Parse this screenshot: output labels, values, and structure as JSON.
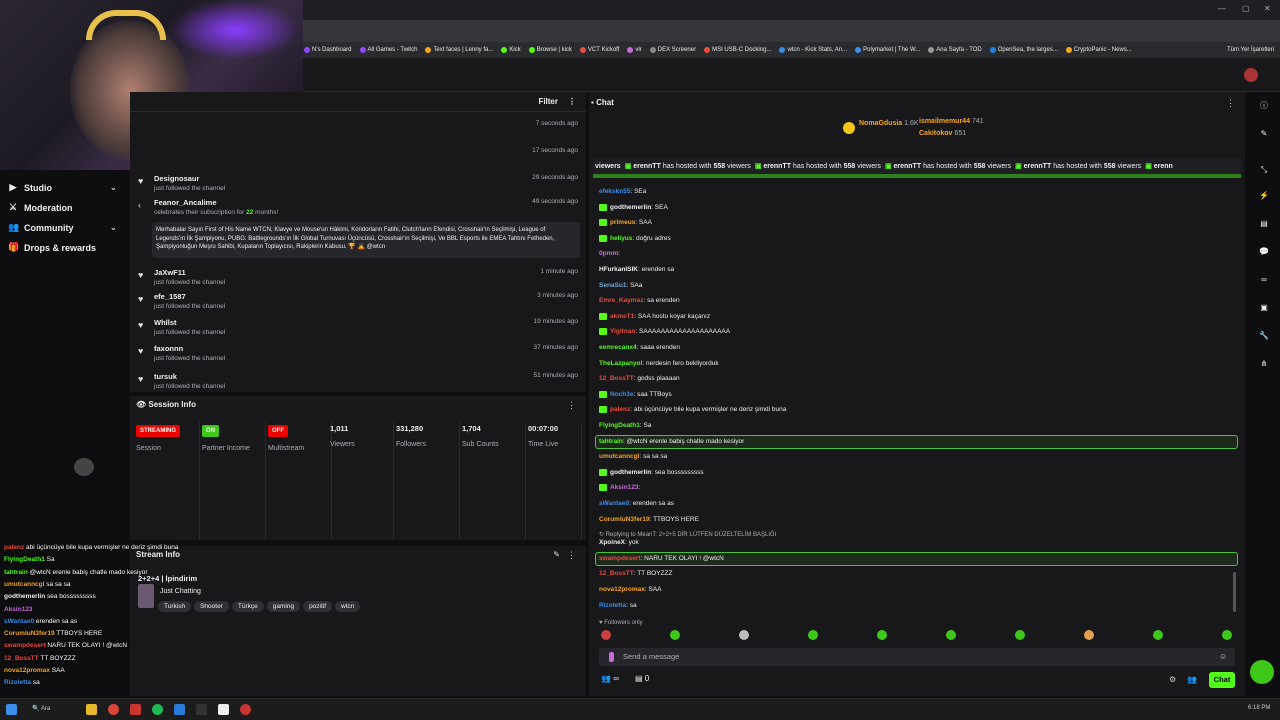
{
  "bookmarks": [
    "N's Dashboard",
    "All Games - Twitch",
    "Text faces | Lenny fa...",
    "Kick",
    "Browse | kick",
    "VCT Kickoff",
    "vlr",
    "DEX Screener",
    "MSI USB-C Docking...",
    "wtcn - Kick Stats, An...",
    "Polymarket | The W...",
    "Ana Sayfa - TOD",
    "OpenSea, the larges...",
    "CryptoPanic - News..."
  ],
  "bookmarks_more": "Tüm Yer İşaretleri",
  "nav": {
    "items": [
      {
        "label": "Studio",
        "icon": "video-icon",
        "chevron": true
      },
      {
        "label": "Moderation",
        "icon": "sword-icon",
        "chevron": false
      },
      {
        "label": "Community",
        "icon": "people-icon",
        "chevron": true
      },
      {
        "label": "Drops & rewards",
        "icon": "gift-icon",
        "chevron": false
      }
    ]
  },
  "activity": {
    "filter_label": "Filter",
    "rows": [
      {
        "name": "",
        "sub": "",
        "time": "7 seconds ago"
      },
      {
        "name": "",
        "sub": "",
        "time": "17 seconds ago"
      },
      {
        "name": "Designosaur",
        "sub": "just followed the channel",
        "time": "29 seconds ago"
      },
      {
        "name": "Feanor_Ancalime",
        "sub": "celebrates their subscription for",
        "months": "22",
        "months_suffix": " months!",
        "time": "49 seconds ago",
        "message": "Merhabalar Sayın First of His Name WTCN, Klavye ve Mouse'un Hâkimi, Koridorların Fatihi, Clutch'ların Efendisi, Crosshair'ın Seçilmişi, League of Legends'ın İlk Şampiyonu, PUBG: Battlegrounds'ın İlk Global Turnuvası Üçüncüsü, Crosshair'ın Seçilmişi, Ve BBL Esports ile EMEA Tahtını Fetheden, Şampiyonluğun Meşru Sahibi, Kupaların Toplayıcısı, Rakiplerin Kabusu. 🏆 🙇 @wtcn"
      },
      {
        "name": "JaXwF11",
        "sub": "just followed the channel",
        "time": "1 minute ago"
      },
      {
        "name": "efe_1587",
        "sub": "just followed the channel",
        "time": "3 minutes ago"
      },
      {
        "name": "Whllst",
        "sub": "just followed the channel",
        "time": "19 minutes ago"
      },
      {
        "name": "faxonnn",
        "sub": "just followed the channel",
        "time": "37 minutes ago"
      },
      {
        "name": "tursuk",
        "sub": "just followed the channel",
        "time": "51 minutes ago"
      }
    ]
  },
  "session": {
    "title": "Session Info",
    "cols": [
      {
        "pill": "STREAMING",
        "pill_color": "#eb0400",
        "label": "Session"
      },
      {
        "pill": "ON",
        "pill_color": "#3ec91a",
        "label": "Partner Income"
      },
      {
        "pill": "OFF",
        "pill_color": "#eb0400",
        "label": "Multistream"
      },
      {
        "value": "1,011",
        "label": "Viewers"
      },
      {
        "value": "331,280",
        "label": "Followers"
      },
      {
        "value": "1,704",
        "label": "Sub Counts"
      },
      {
        "value": "00:07:00",
        "label": "Time Live"
      }
    ]
  },
  "stream_info": {
    "title": "Stream Info",
    "stream_title": "2+2+4 | İpindirim",
    "category": "Just Chatting",
    "tags": [
      "Turkish",
      "Shooter",
      "Türkçe",
      "gaming",
      "pozitif",
      "wtcn"
    ]
  },
  "chat": {
    "title": "Chat",
    "top_gifters": [
      {
        "name": "NomaGdusia",
        "count": "1.6K"
      },
      {
        "name": "ismailmemur44",
        "count": "741"
      },
      {
        "name": "Cakitokov",
        "count": "651"
      }
    ],
    "hosted_segments": [
      {
        "user": "viewers",
        "text": ""
      },
      {
        "user": "erennTT",
        "text": "has hosted with",
        "num": "558",
        "tail": "viewers"
      },
      {
        "user": "erennTT",
        "text": "has hosted with",
        "num": "558",
        "tail": "viewers"
      },
      {
        "user": "erennTT",
        "text": "has hosted with",
        "num": "558",
        "tail": "viewers"
      },
      {
        "user": "erennTT",
        "text": "has hosted with",
        "num": "558",
        "tail": "viewers"
      },
      {
        "user": "erenn",
        "text": "",
        "num": "",
        "tail": ""
      }
    ],
    "messages": [
      {
        "user": "efekskn55",
        "color": "#3b8eea",
        "text": "SEa",
        "badge": false,
        "highlight": false
      },
      {
        "user": "godthemerlin",
        "color": "#efeff1",
        "text": "SEA",
        "badge": true,
        "highlight": false
      },
      {
        "user": "primeus",
        "color": "#f5a623",
        "text": "SAA",
        "badge": true,
        "highlight": false
      },
      {
        "user": "heliyus",
        "color": "#53fc18",
        "text": "doğru adres",
        "badge": true,
        "highlight": false
      },
      {
        "user": "0pmm",
        "color": "#c86dd7",
        "text": "",
        "badge": false,
        "highlight": false
      },
      {
        "user": "HFurkanISIK",
        "color": "#efeff1",
        "text": "erenden sa",
        "badge": false,
        "highlight": false
      },
      {
        "user": "SenaSu1",
        "color": "#6fa8dc",
        "text": "SAa",
        "badge": false,
        "highlight": false
      },
      {
        "user": "Emre_Kaymaz",
        "color": "#e74c3c",
        "text": "sa erenden",
        "badge": false,
        "highlight": false
      },
      {
        "user": "akmeT1",
        "color": "#e74c3c",
        "text": "SAA hostu koyar kaçanız",
        "badge": true,
        "highlight": false
      },
      {
        "user": "Yigitnan",
        "color": "#e74c3c",
        "text": "SAAAAAAAAAAAAAAAAAAAA",
        "badge": true,
        "highlight": false
      },
      {
        "user": "eemrecanx4",
        "color": "#53fc18",
        "text": "saaa erenden",
        "badge": false,
        "highlight": false
      },
      {
        "user": "TheLazpanyol",
        "color": "#53fc18",
        "text": "nerdesin fero bekliyorduk",
        "badge": false,
        "highlight": false
      },
      {
        "user": "12_BossTT",
        "color": "#e74c3c",
        "text": "godss plaaaan",
        "badge": false,
        "highlight": false
      },
      {
        "user": "Noch3e",
        "color": "#3b8eea",
        "text": "saa TTBoys",
        "badge": true,
        "highlight": false
      },
      {
        "user": "palenz",
        "color": "#e74c3c",
        "text": "abi üçüncüye bile kupa vermişler ne deriz şimdi buna",
        "badge": true,
        "highlight": false
      },
      {
        "user": "FlyingDeath1",
        "color": "#53fc18",
        "text": "Sa",
        "badge": false,
        "highlight": false
      },
      {
        "user": "tahtrain",
        "color": "#53fc18",
        "text": "@wtcN erenle babiş chatle mado kesiyor",
        "badge": false,
        "highlight": true
      },
      {
        "user": "umutcanncgl",
        "color": "#f5a623",
        "text": "sa sa sa",
        "badge": false,
        "highlight": false
      },
      {
        "user": "godthemerlin",
        "color": "#efeff1",
        "text": "sea bosssssssss",
        "badge": true,
        "highlight": false
      },
      {
        "user": "Aksin123",
        "color": "#c86dd7",
        "text": "",
        "badge": true,
        "highlight": false
      },
      {
        "user": "sWantae0",
        "color": "#3b8eea",
        "text": "erenden sa as",
        "badge": false,
        "highlight": false
      },
      {
        "user": "CorumluN3fer19",
        "color": "#f5a623",
        "text": "TTBOYS HERE",
        "badge": false,
        "highlight": false
      },
      {
        "user": "XpoineX",
        "color": "#efeff1",
        "text": "yok",
        "badge": false,
        "highlight": false,
        "reply": "Replying to MeanT: 2+2+5 DİR LÜTFEN DÜZELTELİM BAŞLIĞI"
      },
      {
        "user": "swampdesert",
        "color": "#e74c3c",
        "text": "NARU TEK OLAYI ! @wtcN",
        "badge": false,
        "highlight": true
      },
      {
        "user": "12_BossTT",
        "color": "#e74c3c",
        "text": "TT BOYZZZ",
        "badge": false,
        "highlight": false
      },
      {
        "user": "nova12promax",
        "color": "#f5a623",
        "text": "SAA",
        "badge": false,
        "highlight": false
      },
      {
        "user": "Rizoletta",
        "color": "#3b8eea",
        "text": "sa",
        "badge": false,
        "highlight": false
      }
    ],
    "followers_only": "Followers only",
    "input_placeholder": "Send a message",
    "send_label": "Chat",
    "count_left": "∞",
    "count_right": "0"
  },
  "overlay_chat": [
    {
      "user": "palenz",
      "color": "#e74c3c",
      "text": "abi üçüncüye bile kupa vermişler ne deriz şimdi buna"
    },
    {
      "user": "FlyingDeath1",
      "color": "#53fc18",
      "text": "Sa"
    },
    {
      "user": "tahtrain",
      "color": "#53fc18",
      "text": "@wtcN erenle babiş chatle mado kesiyor"
    },
    {
      "user": "umutcanncgl",
      "color": "#f5a623",
      "text": "sa sa sa"
    },
    {
      "user": "godthemerlin",
      "color": "#efeff1",
      "text": "sea bosssssssss"
    },
    {
      "user": "Aksin123",
      "color": "#c86dd7",
      "text": ""
    },
    {
      "user": "sWantae0",
      "color": "#3b8eea",
      "text": "erenden sa as"
    },
    {
      "user": "CorumluN3fer19",
      "color": "#f5a623",
      "text": "TTBOYS HERE"
    },
    {
      "user": "swampdesert",
      "color": "#e74c3c",
      "text": "NARU TEK OLAYI ! @wtcN"
    },
    {
      "user": "12_BossTT",
      "color": "#e74c3c",
      "text": "TT BOYZZZ"
    },
    {
      "user": "nova12promax",
      "color": "#f5a623",
      "text": "SAA"
    },
    {
      "user": "Rizoletta",
      "color": "#3b8eea",
      "text": "sa"
    }
  ],
  "taskbar": {
    "search": "Ara",
    "time": "6:18 PM"
  },
  "colors": {
    "accent": "#53fc18",
    "panel": "#18181b",
    "bg": "#0e0e10",
    "live_red": "#eb0400"
  }
}
